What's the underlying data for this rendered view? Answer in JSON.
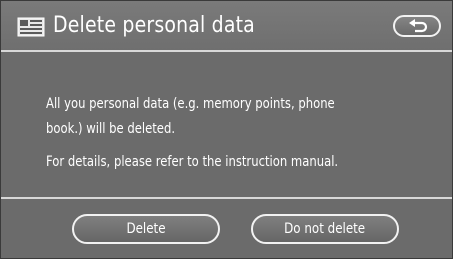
{
  "header": {
    "title": "Delete personal data",
    "title_icon": "personal-data-icon",
    "back_icon": "return-arrow-icon"
  },
  "message": {
    "line1": "All you personal data (e.g. memory points, phone",
    "line2": "book.) will be deleted.",
    "line3": "For details, please refer to the instruction manual."
  },
  "buttons": {
    "delete_label": "Delete",
    "do_not_delete_label": "Do not delete"
  },
  "colors": {
    "background": "#6b6b6b",
    "text": "#ffffff",
    "rule": "#d8d8d8"
  }
}
